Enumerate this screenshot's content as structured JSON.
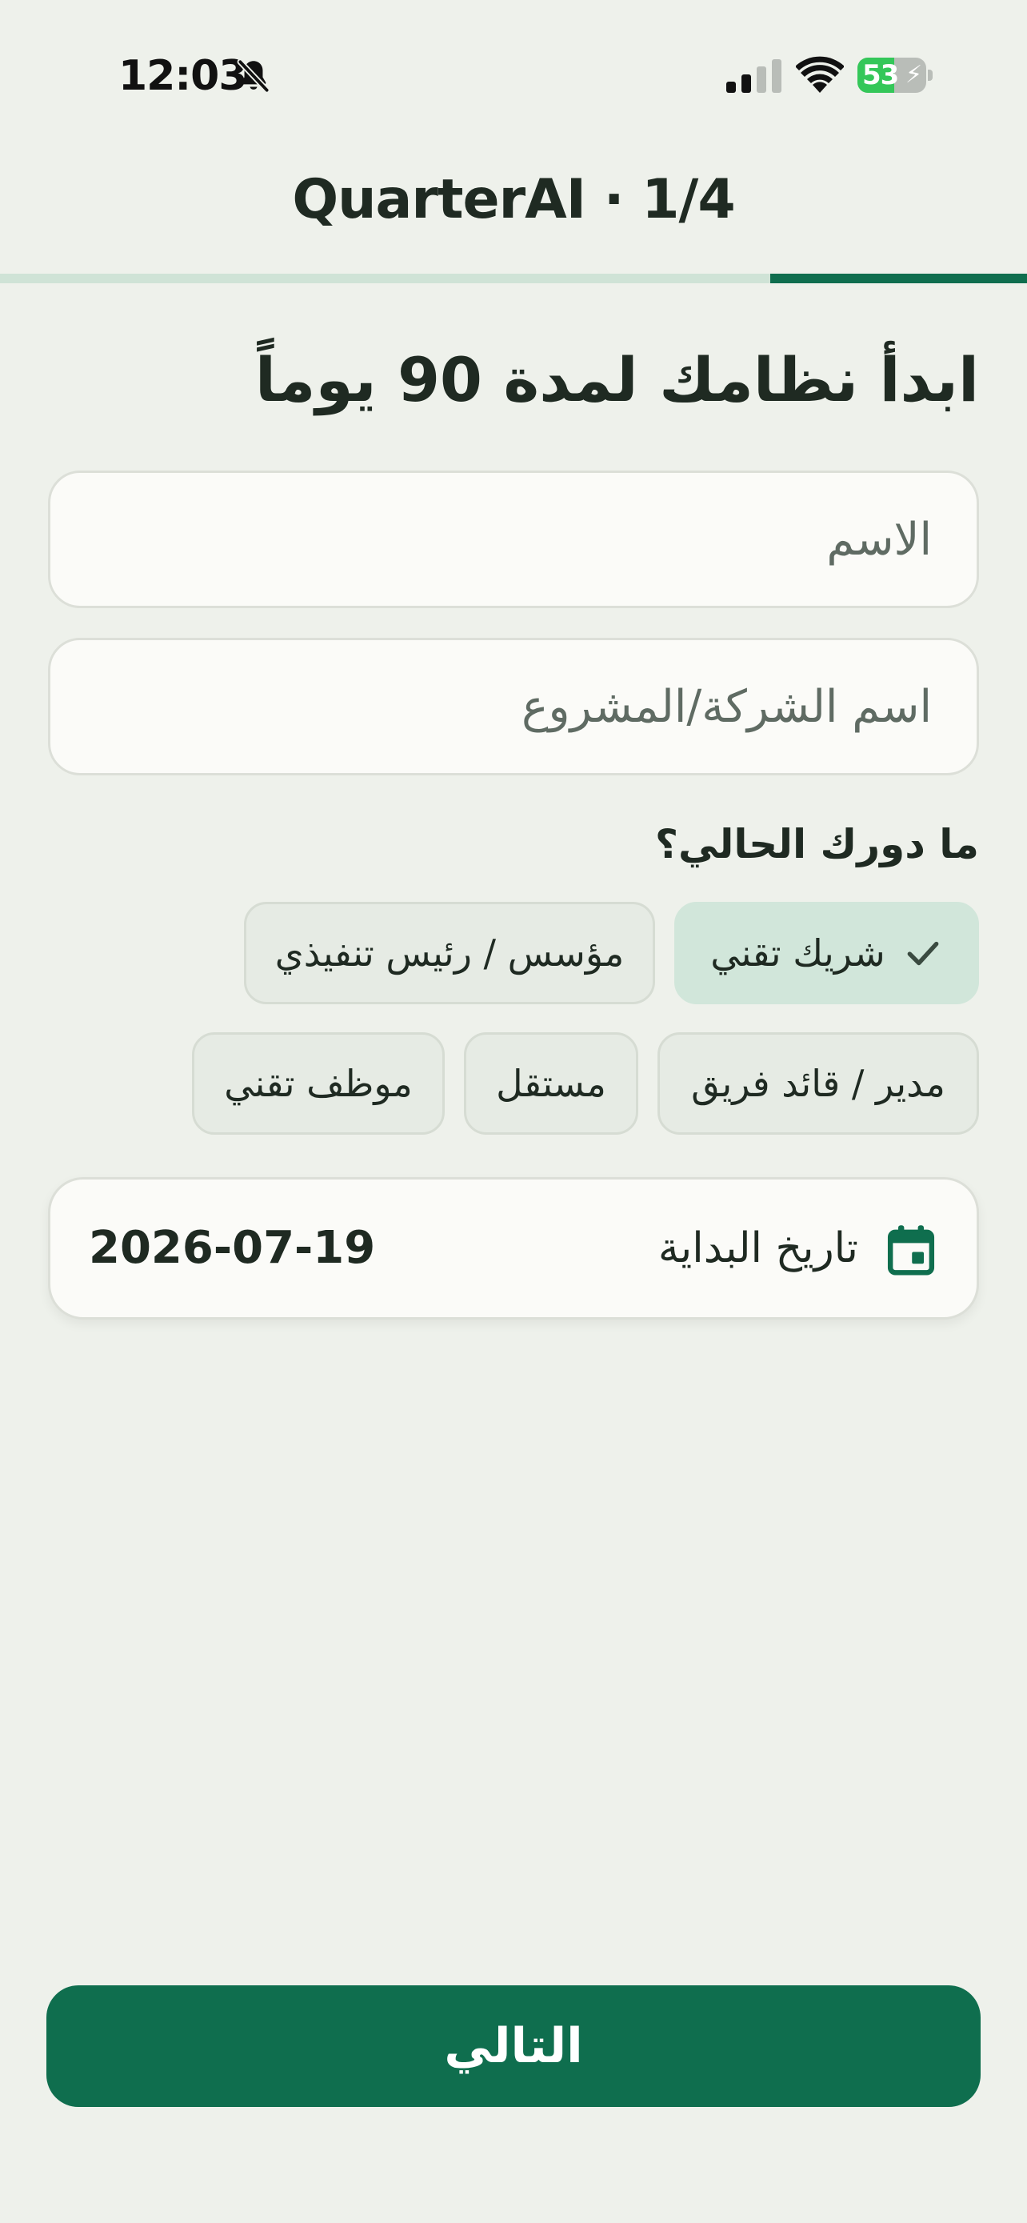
{
  "status_bar": {
    "time": "12:03",
    "battery_level": "53",
    "battery_fraction": 0.53,
    "icons": [
      "bell-slash-icon",
      "cellular-signal-icon",
      "wifi-icon",
      "battery-charging-icon"
    ]
  },
  "header": {
    "title": "QuarterAI · 1/4",
    "progress_fraction": 0.25
  },
  "main": {
    "heading": "ابدأ نظامك لمدة 90 يوماً",
    "name_placeholder": "الاسم",
    "company_placeholder": "اسم الشركة/المشروع",
    "role_question": "ما دورك الحالي؟",
    "roles": [
      {
        "label": "شريك تقني",
        "selected": true
      },
      {
        "label": "مؤسس / رئيس تنفيذي",
        "selected": false
      },
      {
        "label": "مدير / قائد فريق",
        "selected": false
      },
      {
        "label": "مستقل",
        "selected": false
      },
      {
        "label": "موظف تقني",
        "selected": false
      }
    ],
    "start_date": {
      "label": "تاريخ البداية",
      "value": "2026-07-19",
      "icon": "calendar-icon"
    }
  },
  "footer": {
    "next_label": "التالي"
  },
  "colors": {
    "background": "#eef1eb",
    "accent": "#0f6e4e",
    "selected_chip": "#d1e6da",
    "progress_track": "#cfe3d6"
  }
}
